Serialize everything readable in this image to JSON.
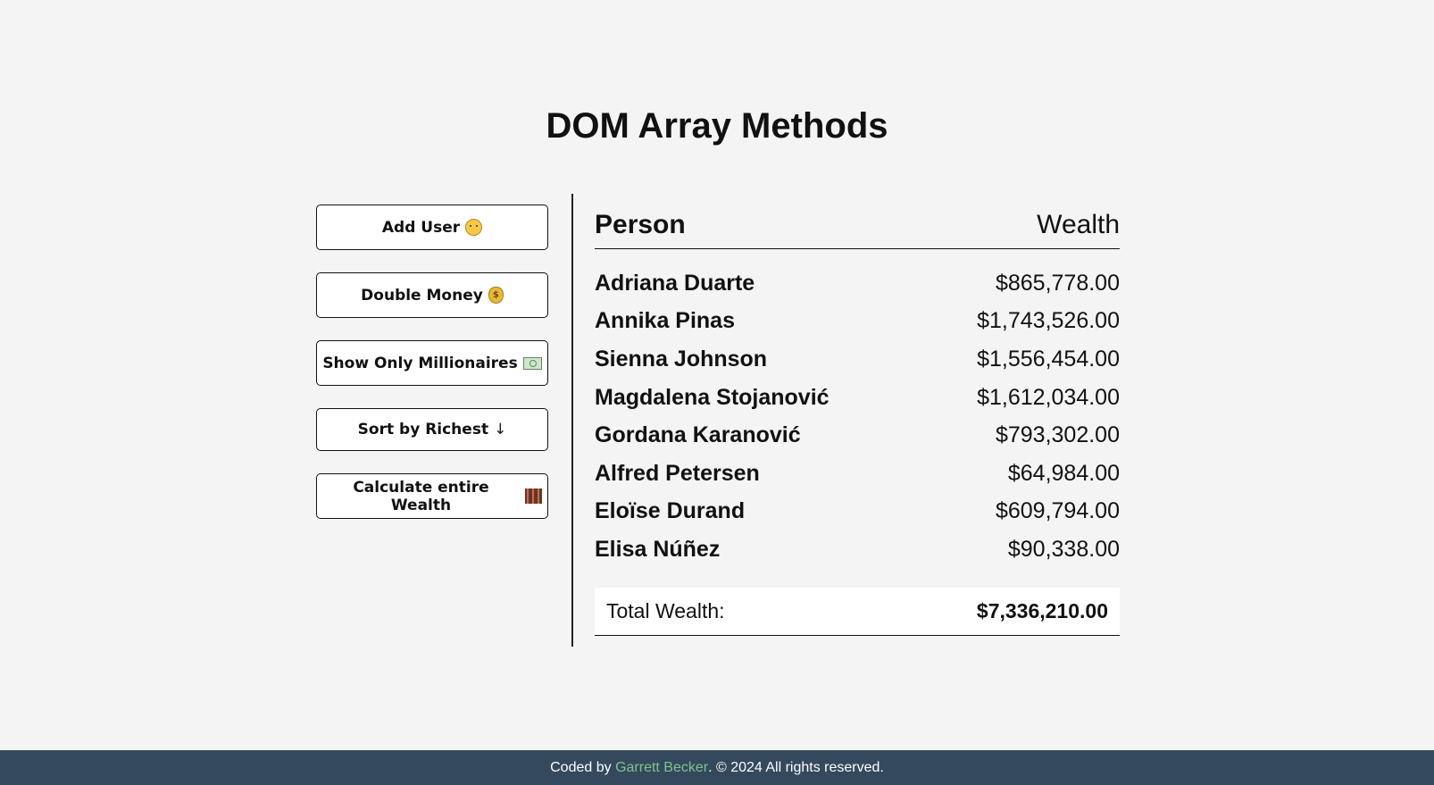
{
  "header": {
    "title": "DOM Array Methods"
  },
  "buttons": {
    "add_user": {
      "label": "Add User",
      "icon": "face-icon"
    },
    "double_money": {
      "label": "Double Money",
      "icon": "money-bag-icon"
    },
    "show_millionaires": {
      "label": "Show Only Millionaires",
      "icon": "dollar-bill-icon"
    },
    "sort_richest": {
      "label": "Sort by Richest",
      "icon_glyph": "↓"
    },
    "calculate_wealth": {
      "label": "Calculate entire Wealth",
      "icon": "abacus-icon"
    }
  },
  "table": {
    "col_person": "Person",
    "col_wealth": "Wealth",
    "rows": [
      {
        "name": "Adriana Duarte",
        "wealth": "$865,778.00"
      },
      {
        "name": "Annika Pinas",
        "wealth": "$1,743,526.00"
      },
      {
        "name": "Sienna Johnson",
        "wealth": "$1,556,454.00"
      },
      {
        "name": "Magdalena Stojanović",
        "wealth": "$1,612,034.00"
      },
      {
        "name": "Gordana Karanović",
        "wealth": "$793,302.00"
      },
      {
        "name": "Alfred Petersen",
        "wealth": "$64,984.00"
      },
      {
        "name": "Eloïse Durand",
        "wealth": "$609,794.00"
      },
      {
        "name": "Elisa Núñez",
        "wealth": "$90,338.00"
      }
    ],
    "total_label": "Total Wealth:",
    "total_value": "$7,336,210.00"
  },
  "footer": {
    "prefix": "Coded by ",
    "author": "Garrett Becker",
    "suffix": ". © 2024 All rights reserved."
  },
  "colors": {
    "background": "#f4f4f4",
    "footer_bg": "#34495e",
    "author_link": "#7fc38a"
  }
}
